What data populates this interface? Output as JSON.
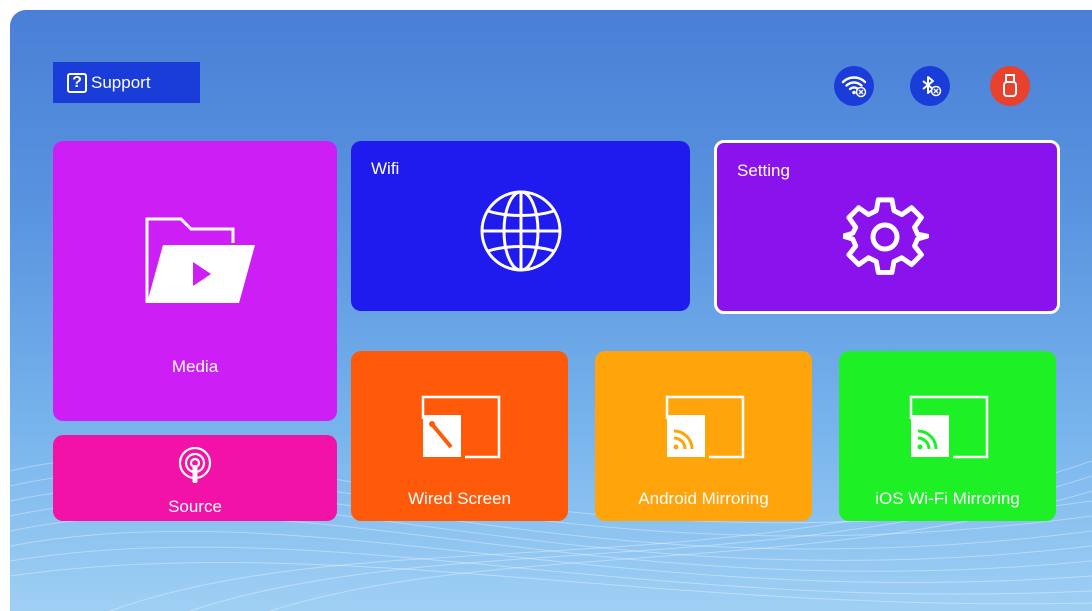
{
  "support": {
    "label": "Support"
  },
  "status_icons": [
    {
      "name": "wifi-disconnected-icon",
      "color": "#1a3cd8"
    },
    {
      "name": "bluetooth-disconnected-icon",
      "color": "#1a3cd8"
    },
    {
      "name": "usb-icon",
      "color": "#e8412e"
    }
  ],
  "tiles": {
    "media": {
      "label": "Media",
      "color": "#cc1ef5",
      "icon": "folder-play-icon"
    },
    "wifi": {
      "label": "Wifi",
      "color": "#1f1bef",
      "icon": "globe-icon"
    },
    "setting": {
      "label": "Setting",
      "color": "#8a12ec",
      "icon": "gear-icon"
    },
    "source": {
      "label": "Source",
      "color": "#f212a8",
      "icon": "podcast-icon"
    },
    "wired": {
      "label": "Wired Screen",
      "color": "#ff5a0a",
      "icon": "wired-screen-icon"
    },
    "android": {
      "label": "Android Mirroring",
      "color": "#ffa40a",
      "icon": "screen-cast-icon"
    },
    "ios": {
      "label": "iOS Wi-Fi Mirroring",
      "color": "#1ef026",
      "icon": "screen-cast-icon"
    }
  }
}
